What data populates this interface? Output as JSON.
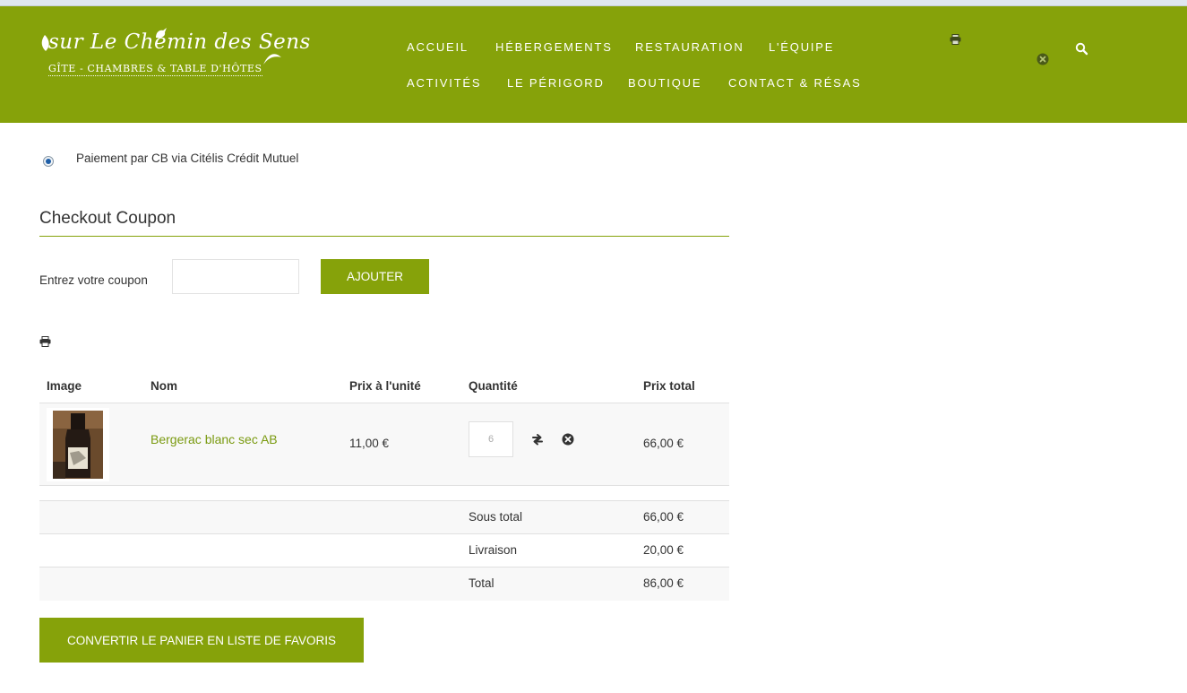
{
  "site": {
    "logo_main": "sur Le Chemin des Sens",
    "logo_sub": "GÎTE - CHAMBRES & TABLE D'HÔTES"
  },
  "nav": {
    "row1": [
      "ACCUEIL",
      "HÉBERGEMENTS",
      "RESTAURATION",
      "L'ÉQUIPE"
    ],
    "row2": [
      "ACTIVITÉS",
      "LE PÉRIGORD",
      "BOUTIQUE",
      "CONTACT & RÉSAS"
    ]
  },
  "header_icons": [
    "print-icon",
    "close-circle-icon",
    "search-icon"
  ],
  "payment": {
    "option_label": "Paiement par CB via Citélis Crédit Mutuel",
    "selected": true
  },
  "coupon": {
    "title": "Checkout Coupon",
    "label": "Entrez votre coupon",
    "value": "",
    "button": "AJOUTER"
  },
  "cart": {
    "headers": [
      "Image",
      "Nom",
      "Prix à l'unité",
      "Quantité",
      "Prix total"
    ],
    "items": [
      {
        "name": "Bergerac blanc sec AB",
        "unit_price": "11,00 €",
        "quantity": "6",
        "total": "66,00 €"
      }
    ],
    "summary": [
      {
        "label": "Sous total",
        "value": "66,00 €"
      },
      {
        "label": "Livraison",
        "value": "20,00 €"
      },
      {
        "label": "Total",
        "value": "86,00 €"
      }
    ]
  },
  "favorites_button": "CONVERTIR LE PANIER EN LISTE DE FAVORIS",
  "colors": {
    "brand_green": "#86a20a",
    "link_green": "#7a9a10",
    "text": "#333333",
    "row_bg": "#f8f8f8"
  }
}
